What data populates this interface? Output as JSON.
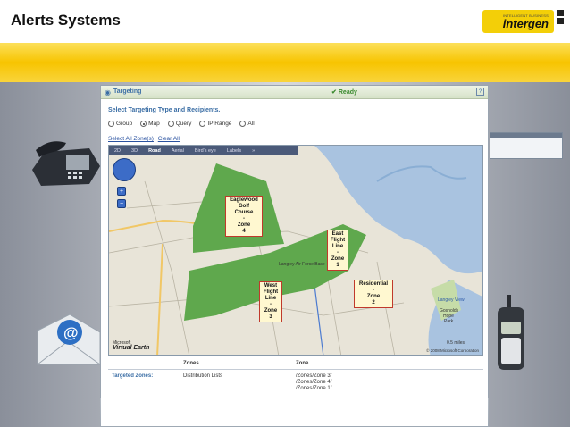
{
  "slide": {
    "title": "Alerts Systems",
    "logo": {
      "tagline": "INTELLIGENT BUSINESS",
      "wordmark": "intergen",
      "color": "#f3cf08"
    }
  },
  "app": {
    "title": "Targeting",
    "status": "Ready",
    "help_icon": "?",
    "section_label": "Select Targeting Type and Recipients.",
    "radios": [
      {
        "label": "Group",
        "selected": false
      },
      {
        "label": "Map",
        "selected": true
      },
      {
        "label": "Query",
        "selected": false
      },
      {
        "label": "IP Range",
        "selected": false
      },
      {
        "label": "All",
        "selected": false
      }
    ],
    "links": {
      "select_all": "Select All Zone(s)",
      "clear_all": "Clear All"
    },
    "map": {
      "toolbar": [
        "2D",
        "3D",
        "Road",
        "Aerial",
        "Bird's eye",
        "Labels",
        "»"
      ],
      "toolbar_active": "Road",
      "zones": [
        {
          "lines": [
            "Eaglewood",
            "Golf",
            "Course",
            "-",
            "Zone",
            "4"
          ]
        },
        {
          "lines": [
            "East",
            "Flight",
            "Line",
            "-",
            "Zone",
            "1"
          ]
        },
        {
          "lines": [
            "Residential",
            "-",
            "Zone",
            "2"
          ]
        },
        {
          "lines": [
            "West",
            "Flight",
            "Line",
            "-",
            "Zone",
            "3"
          ]
        }
      ],
      "brand_small": "Microsoft",
      "brand": "Virtual Earth",
      "copyright": "© 2008 Microsoft Corporation",
      "scale": "0.5 miles",
      "place_label": "Langley View",
      "park_label": [
        "Gosnolds",
        "Hope",
        "Park"
      ],
      "base_label": "Langley Air Force Base",
      "zone_color": "#5fa84d"
    },
    "table": {
      "headers": [
        "Zones",
        "Zone"
      ],
      "row_label": "Targeted Zones:",
      "distribution": "Distribution Lists",
      "zones": [
        "/Zones/Zone 3/",
        "/Zones/Zone 4/",
        "/Zones/Zone 1/"
      ]
    }
  }
}
